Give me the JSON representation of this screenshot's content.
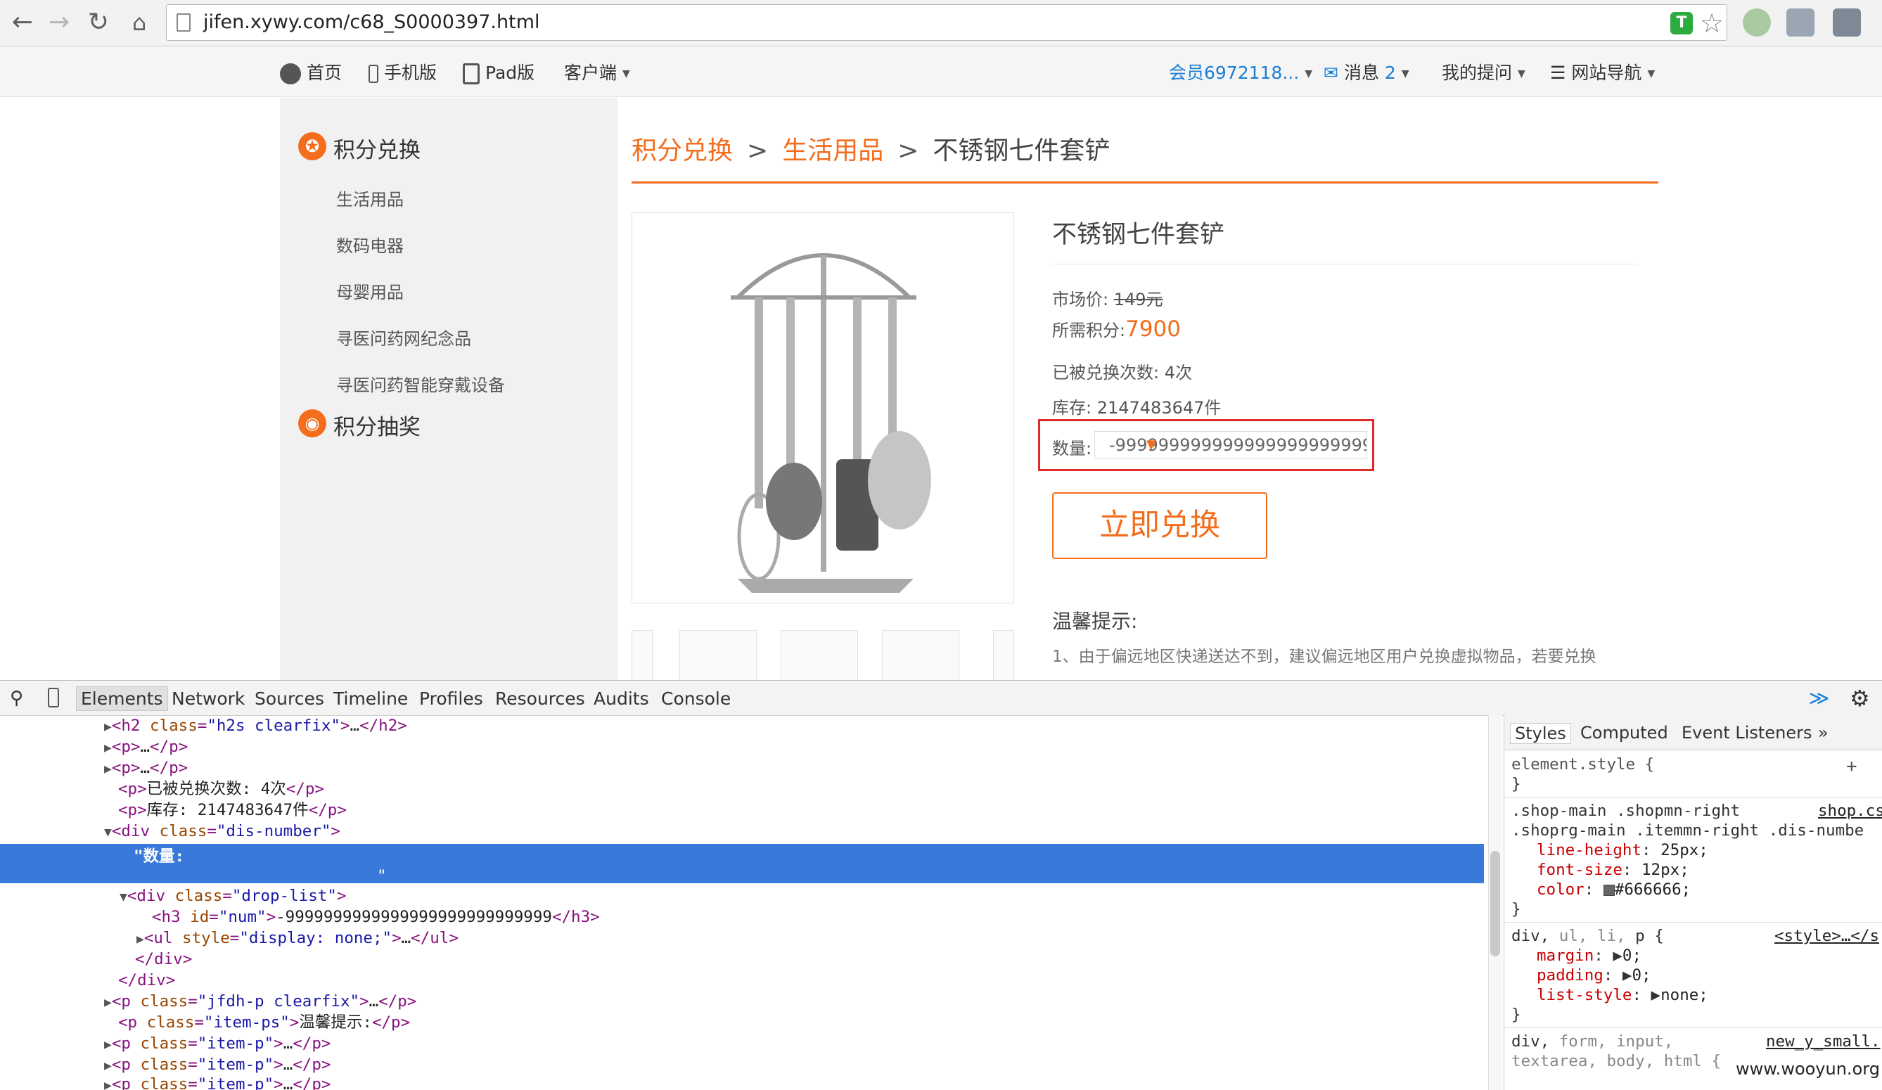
{
  "browser": {
    "url": "jifen.xywy.com/c68_S0000397.html"
  },
  "topbar": {
    "home": "首页",
    "mobile": "手机版",
    "pad": "Pad版",
    "client": "客户端",
    "member": "会员6972118...",
    "messages_label": "消息",
    "messages_count": "2",
    "questions": "我的提问",
    "site_nav": "网站导航"
  },
  "sidebar": {
    "section1": "积分兑换",
    "items": [
      "生活用品",
      "数码电器",
      "母婴用品",
      "寻医问药网纪念品",
      "寻医问药智能穿戴设备"
    ],
    "section2": "积分抽奖"
  },
  "breadcrumb": {
    "root": "积分兑换",
    "sep": ">",
    "category": "生活用品",
    "current": "不锈钢七件套铲"
  },
  "product": {
    "title": "不锈钢七件套铲",
    "market_label": "市场价:",
    "market_price": "149元",
    "points_label": "所需积分:",
    "points": "7900",
    "exchanged": "已被兑换次数: 4次",
    "stock": "库存: 2147483647件",
    "qty_label": "数量:",
    "qty_value": "-9999999999999999999999999999",
    "redeem_button": "立即兑换",
    "tip_title": "温馨提示:",
    "tip_text": "1、由于偏远地区快递送达不到，建议偏远地区用户兑换虚拟物品，若要兑换"
  },
  "devtools": {
    "tabs": [
      "Elements",
      "Network",
      "Sources",
      "Timeline",
      "Profiles",
      "Resources",
      "Audits",
      "Console"
    ],
    "styles_tabs": [
      "Styles",
      "Computed",
      "Event Listeners",
      "»"
    ],
    "watermark": "www.wooyun.org"
  }
}
